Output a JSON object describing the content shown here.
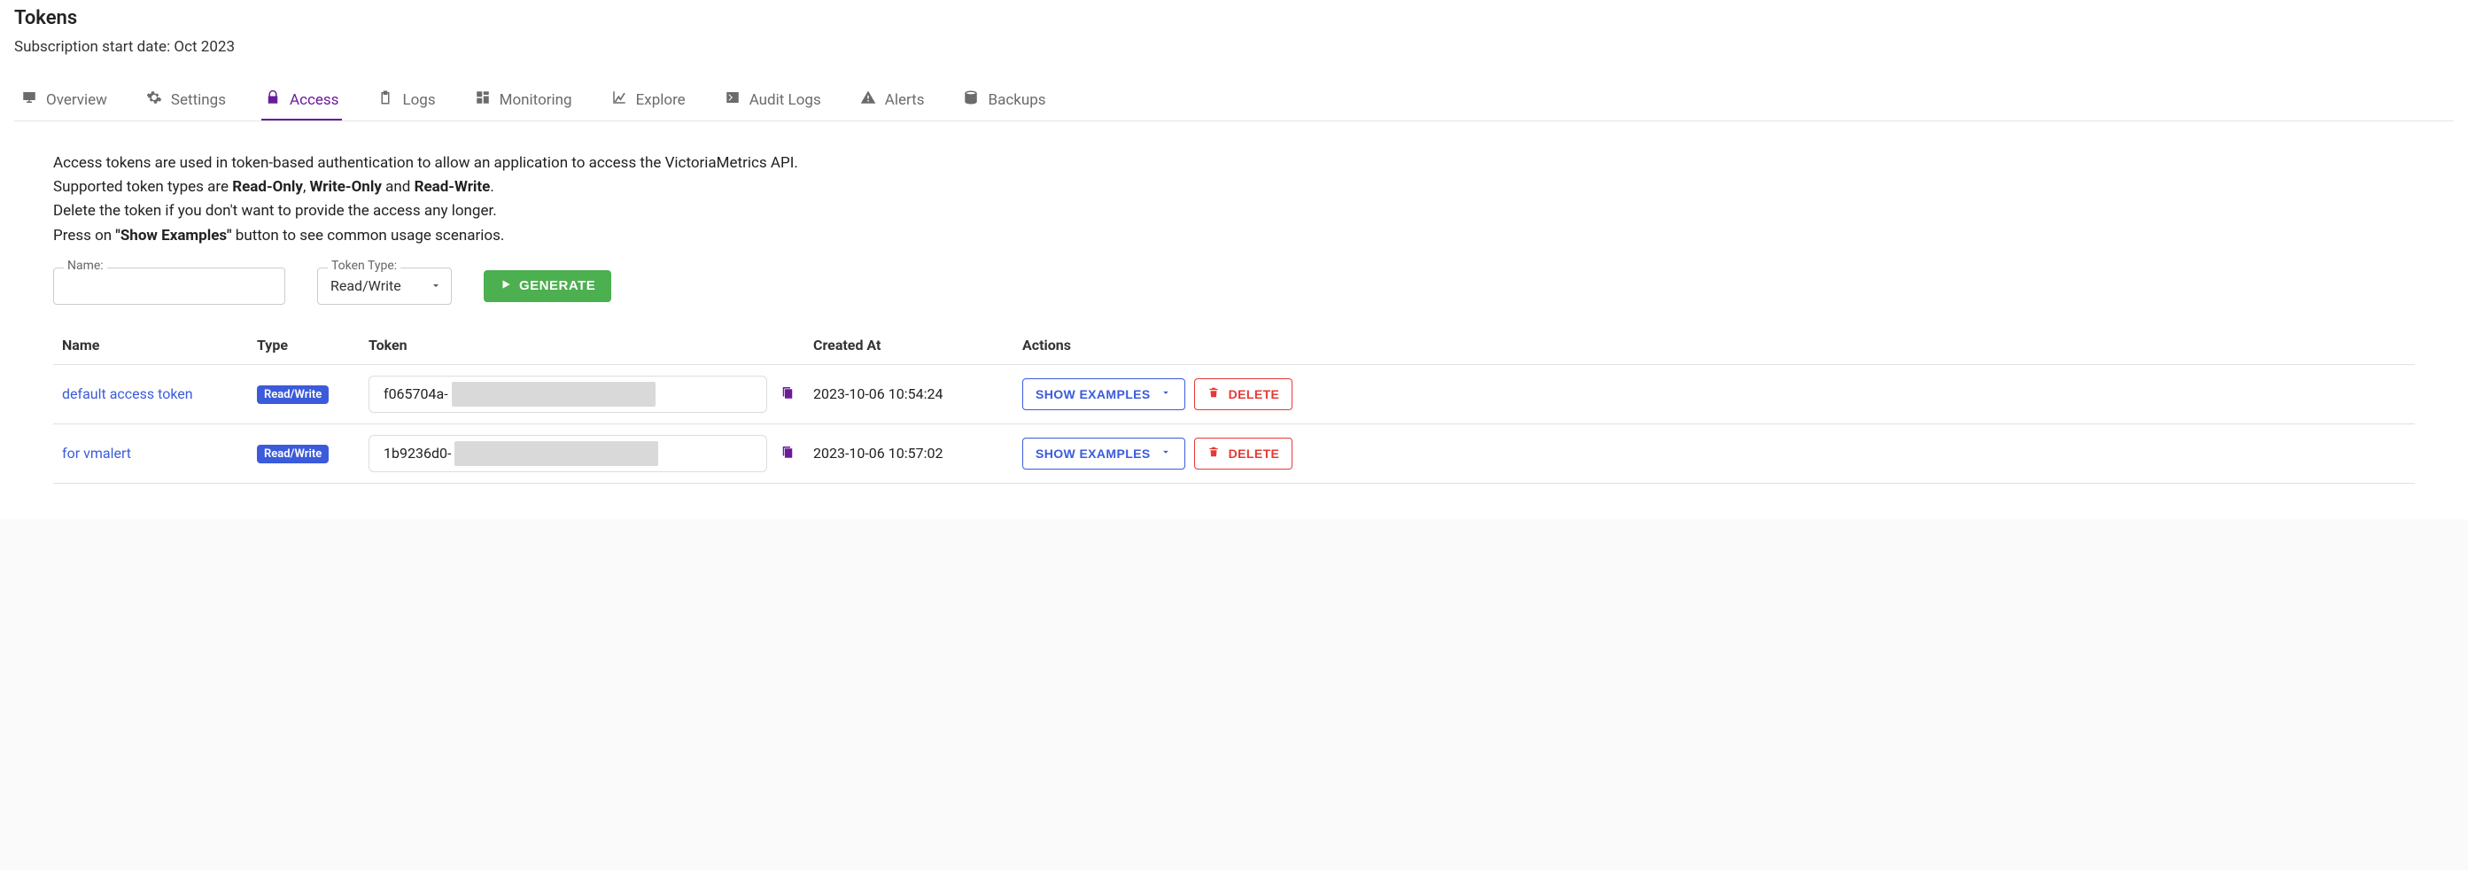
{
  "header": {
    "title": "Tokens",
    "sub_prefix": "Subscription start date: ",
    "sub_date": "Oct 2023"
  },
  "tabs": [
    {
      "id": "overview",
      "label": "Overview",
      "icon": "monitor-icon"
    },
    {
      "id": "settings",
      "label": "Settings",
      "icon": "gear-icon"
    },
    {
      "id": "access",
      "label": "Access",
      "icon": "lock-icon",
      "active": true
    },
    {
      "id": "logs",
      "label": "Logs",
      "icon": "clipboard-icon"
    },
    {
      "id": "monitoring",
      "label": "Monitoring",
      "icon": "dashboard-icon"
    },
    {
      "id": "explore",
      "label": "Explore",
      "icon": "chart-icon"
    },
    {
      "id": "audit-logs",
      "label": "Audit Logs",
      "icon": "terminal-icon"
    },
    {
      "id": "alerts",
      "label": "Alerts",
      "icon": "warning-icon"
    },
    {
      "id": "backups",
      "label": "Backups",
      "icon": "database-icon"
    }
  ],
  "description": {
    "line1": "Access tokens are used in token-based authentication to allow an application to access the VictoriaMetrics API.",
    "line2_pre": "Supported token types are ",
    "line2_b1": "Read-Only",
    "line2_sep1": ", ",
    "line2_b2": "Write-Only",
    "line2_sep2": " and ",
    "line2_b3": "Read-Write",
    "line2_post": ".",
    "line3": "Delete the token if you don't want to provide the access any longer.",
    "line4_pre": "Press on ",
    "line4_b": "\"Show Examples\"",
    "line4_post": " button to see common usage scenarios."
  },
  "form": {
    "name_label": "Name:",
    "name_value": "",
    "type_label": "Token Type:",
    "type_value": "Read/Write",
    "generate_label": "GENERATE"
  },
  "table": {
    "headers": {
      "name": "Name",
      "type": "Type",
      "token": "Token",
      "created_at": "Created At",
      "actions": "Actions"
    },
    "rows": [
      {
        "name": "default access token",
        "type": "Read/Write",
        "token_prefix": "f065704a-",
        "created_at": "2023-10-06 10:54:24"
      },
      {
        "name": "for vmalert",
        "type": "Read/Write",
        "token_prefix": "1b9236d0-",
        "created_at": "2023-10-06 10:57:02"
      }
    ],
    "show_examples_label": "SHOW EXAMPLES",
    "delete_label": "DELETE"
  }
}
